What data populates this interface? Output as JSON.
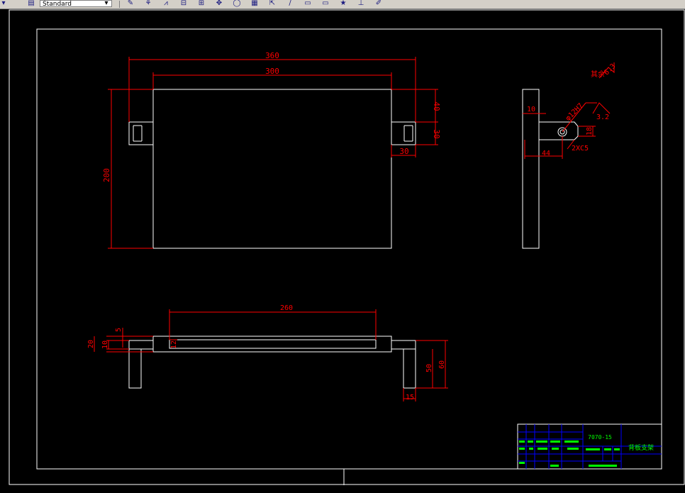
{
  "toolbar": {
    "style_dropdown": "Standard",
    "buttons": [
      {
        "name": "edit-dimension-icon",
        "glyph": "✎"
      },
      {
        "name": "cut-icon",
        "glyph": "⚘"
      },
      {
        "name": "angular-dim-icon",
        "glyph": "⩘"
      },
      {
        "name": "baseline-dim-icon",
        "glyph": "⊟"
      },
      {
        "name": "continue-dim-icon",
        "glyph": "⊞"
      },
      {
        "name": "center-mark-icon",
        "glyph": "✥"
      },
      {
        "name": "radius-dim-icon",
        "glyph": "◯"
      },
      {
        "name": "tolerance-icon",
        "glyph": "▦"
      },
      {
        "name": "leader-icon",
        "glyph": "⇱"
      },
      {
        "name": "oblique-icon",
        "glyph": "∕"
      },
      {
        "name": "box-icon",
        "glyph": "▭"
      },
      {
        "name": "box2-icon",
        "glyph": "▭"
      },
      {
        "name": "star-icon",
        "glyph": "★"
      },
      {
        "name": "pin-icon",
        "glyph": "⊥"
      },
      {
        "name": "paint-icon",
        "glyph": "✐"
      }
    ]
  },
  "colors": {
    "background": "#000000",
    "geometry": "#ffffff",
    "dimension": "#ff0000",
    "table": "#0000ff",
    "table_text": "#00ff00"
  },
  "dims": {
    "top_overall": "360",
    "top_inner": "300",
    "left_height": "200",
    "right_40": "40",
    "right_30": "30",
    "right_30b": "30",
    "front_10": "10",
    "front_44": "44",
    "front_18": "18",
    "front_hole": "φ12H7",
    "front_chamfer": "2XC5",
    "front_roughness": "3.2",
    "corner_roughness": "6.3",
    "corner_label": "其余",
    "bottom_260": "260",
    "bottom_5": "5",
    "bottom_20": "20",
    "bottom_10": "10",
    "bottom_12": "12",
    "bottom_50": "50",
    "bottom_60": "60",
    "bottom_15": "15"
  },
  "title_block": {
    "drawing_no": "7070-15",
    "part_name": "背板支架"
  }
}
